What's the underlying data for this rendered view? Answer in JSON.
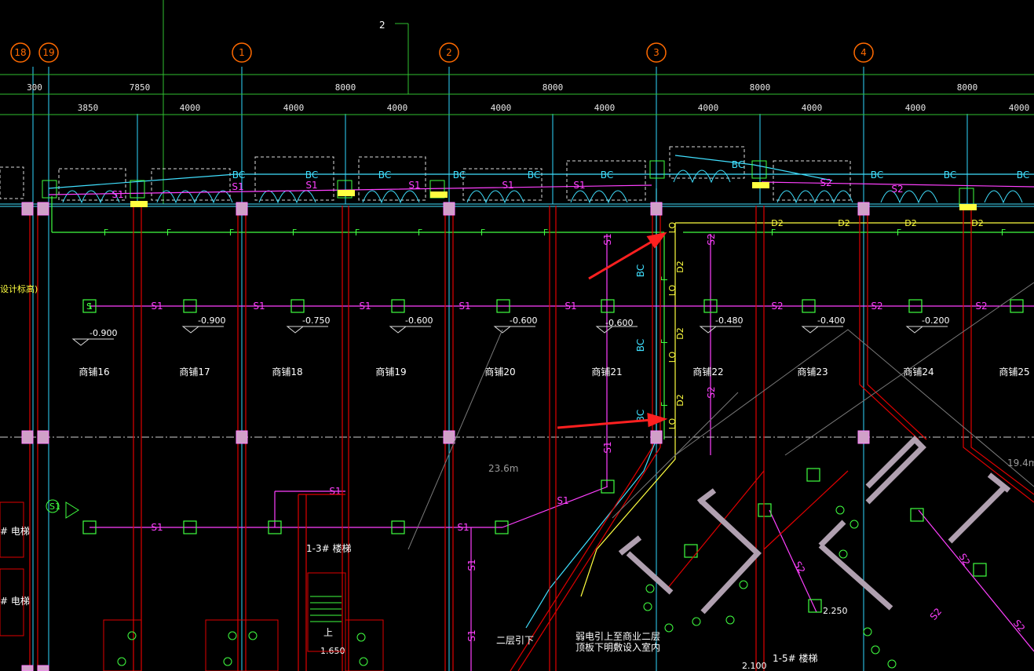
{
  "drawing": {
    "top_label": "2",
    "axis_labels": [
      "18",
      "19",
      "1",
      "2",
      "3",
      "4"
    ],
    "top_dimensions": [
      "300",
      "7850",
      "8000",
      "8000",
      "8000",
      "8000"
    ],
    "sub_dimensions": [
      "3850",
      "4000",
      "4000",
      "4000",
      "4000",
      "4000",
      "4000",
      "4000",
      "4000"
    ],
    "shops": [
      "商铺16",
      "商铺17",
      "商铺18",
      "商铺19",
      "商铺20",
      "商铺21",
      "商铺22",
      "商铺23",
      "商铺24",
      "商铺25"
    ],
    "levels": [
      "-0.900",
      "-0.900",
      "-0.750",
      "-0.600",
      "-0.600",
      "-0.600",
      "-0.480",
      "-0.400",
      "-0.200"
    ],
    "line_codes": {
      "s1": "S1",
      "s2": "S2",
      "f": "F",
      "bc": "BC",
      "d2": "D2",
      "lo": "LO"
    },
    "stair_13": "1-3# 楼梯",
    "stair_15": "1-5# 楼梯",
    "left_note": "设计标高)",
    "left_elevator_1": "# 电梯",
    "left_elevator_2": "# 电梯",
    "distance_1": "23.6m",
    "distance_2": "19.4m",
    "note_second_floor": "二层引下",
    "note_cable": "弱电引上至商业二层",
    "note_cable_2": "顶板下明敷设入室内",
    "elev_1650": "1.650",
    "elev_2250": "2.250",
    "elev_2100": "2.100",
    "up_label": "上",
    "colors": {
      "grid": "#00c8c8",
      "wall": "#e00000",
      "s1": "#ff40ff",
      "fire": "#40ff40",
      "bc": "#40e0ff",
      "d2": "#ffff40",
      "arrow": "#ff2020"
    }
  }
}
